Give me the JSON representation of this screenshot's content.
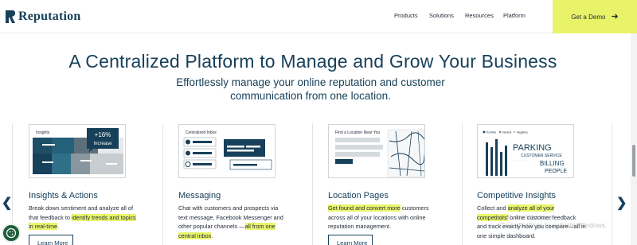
{
  "header": {
    "brand": "Reputation",
    "nav": [
      "Products",
      "Solutions",
      "Resources",
      "Platform"
    ],
    "cta_label": "Get a Demo",
    "cta_color": "#e9f36a"
  },
  "hero": {
    "title": "A Centralized Platform to Manage and Grow Your Business",
    "subtitle": "Effortlessly manage your online reputation and customer communication from one location."
  },
  "cards": [
    {
      "title": "Insights & Actions",
      "desc_pre": "Break down sentiment and analyze all of that feedback to ",
      "desc_hl": "identify trends and topics in real-time",
      "desc_post": ".",
      "button": "Learn More",
      "image_label": "Insights",
      "badge_value": "+16%",
      "badge_text": "Increase"
    },
    {
      "title": "Messaging",
      "desc_pre": "Chat with customers and prospects via text message, Facebook Messenger and other popular channels —",
      "desc_hl": "all from one central inbox",
      "desc_post": ".",
      "image_label": "Centralized Inbox"
    },
    {
      "title": "Location Pages",
      "desc_pre": "",
      "desc_hl": "Get found and convert more",
      "desc_post": " customers across all of your locations with online reputation management.",
      "button": "Learn More",
      "image_label": "Find a Location Near You"
    },
    {
      "title": "Competitive Insights",
      "desc_pre": "Collect and ",
      "desc_hl": "analyze all of your competitors'",
      "desc_post": " online customer feedback and track exactly how you compare—all in one simple dashboard.",
      "image_legend": [
        "Positive",
        "Neutral",
        "Negative"
      ],
      "image_words": [
        "PARKING",
        "CUSTOMER SERVICE",
        "BILLING",
        "PEOPLE"
      ]
    }
  ],
  "watermark": {
    "line1": "Activate Windows",
    "line2": "Go to Settings to activate Windows."
  },
  "icons": {
    "prev": "chevron-left-icon",
    "next": "chevron-right-icon",
    "cta_arrow": "arrow-right-icon",
    "cookie": "cookie-icon"
  }
}
